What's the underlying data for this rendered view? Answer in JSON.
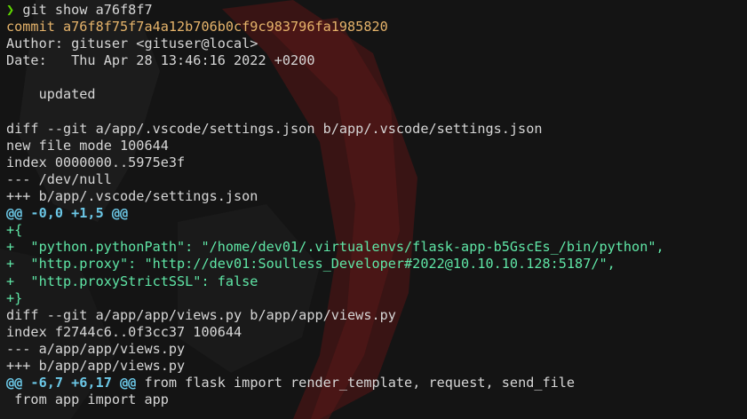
{
  "prompt": {
    "symbol": "❯",
    "command": "git show a76f8f7"
  },
  "commit": {
    "line": "commit a76f8f75f7a4a12b706b0cf9c983796fa1985820",
    "author": "Author: gituser <gituser@local>",
    "date": "Date:   Thu Apr 28 13:46:16 2022 +0200",
    "message": "    updated"
  },
  "diff1": {
    "header": "diff --git a/app/.vscode/settings.json b/app/.vscode/settings.json",
    "mode": "new file mode 100644",
    "index": "index 0000000..5975e3f",
    "minus_file": "--- /dev/null",
    "plus_file": "+++ b/app/.vscode/settings.json",
    "hunk": "@@ -0,0 +1,5 @@",
    "lines": [
      "+{",
      "+  \"python.pythonPath\": \"/home/dev01/.virtualenvs/flask-app-b5GscEs_/bin/python\",",
      "+  \"http.proxy\": \"http://dev01:Soulless_Developer#2022@10.10.10.128:5187/\",",
      "+  \"http.proxyStrictSSL\": false",
      "+}"
    ]
  },
  "diff2": {
    "header": "diff --git a/app/app/views.py b/app/app/views.py",
    "index": "index f2744c6..0f3cc37 100644",
    "minus_file": "--- a/app/app/views.py",
    "plus_file": "+++ b/app/app/views.py",
    "hunk": "@@ -6,7 +6,17 @@",
    "hunk_context": " from flask import render_template, request, send_file",
    "context_line": " from app import app"
  },
  "colors": {
    "background": "#141414",
    "prompt": "#5fd700",
    "commit_hash": "#e5b36a",
    "hunk_header": "#6bc7e6",
    "added_line": "#5fe6a6",
    "text": "#d6d6d6",
    "wallpaper_accent": "#5a1818"
  }
}
